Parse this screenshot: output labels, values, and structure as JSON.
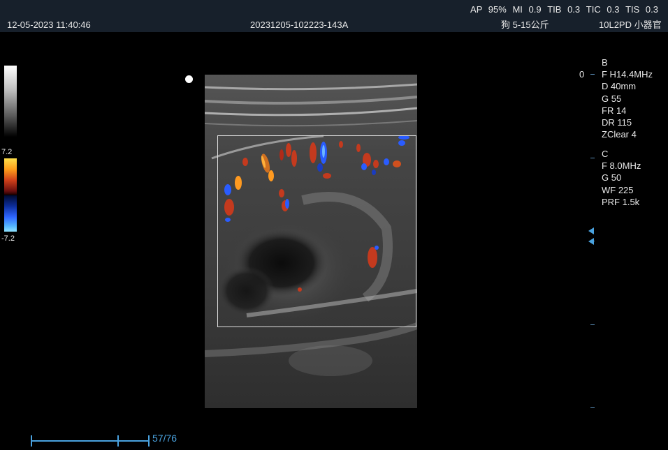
{
  "header": {
    "datetime": "12-05-2023 11:40:46",
    "patient_id": "20231205-102223-143A",
    "subject": "狗 5-15公斤",
    "probe_preset": "10L2PD 小器官",
    "acoustic": {
      "ap_label": "AP",
      "ap_value": "95%",
      "mi_label": "MI",
      "mi_value": "0.9",
      "tib_label": "TIB",
      "tib_value": "0.3",
      "tic_label": "TIC",
      "tic_value": "0.3",
      "tis_label": "TIS",
      "tis_value": "0.3"
    }
  },
  "color_scale": {
    "max_label": "7.2",
    "min_label": "-7.2"
  },
  "b_mode_params": {
    "mode": "B",
    "frequency": "F H14.4MHz",
    "depth": "D 40mm",
    "gain": "G 55",
    "frame_rate": "FR 14",
    "dynamic_range": "DR 115",
    "zclear": "ZClear 4"
  },
  "color_params": {
    "mode": "C",
    "frequency": "F 8.0MHz",
    "gain": "G 50",
    "wall_filter": "WF 225",
    "prf": "PRF 1.5k"
  },
  "depth_scale": {
    "zero_label": "0"
  },
  "cine": {
    "frame_counter": "57/76"
  },
  "colors": {
    "header_bg": "#17202b",
    "accent_blue": "#4aa3e0",
    "doppler_red": "#c43a1e",
    "doppler_blue": "#2a5cff"
  }
}
